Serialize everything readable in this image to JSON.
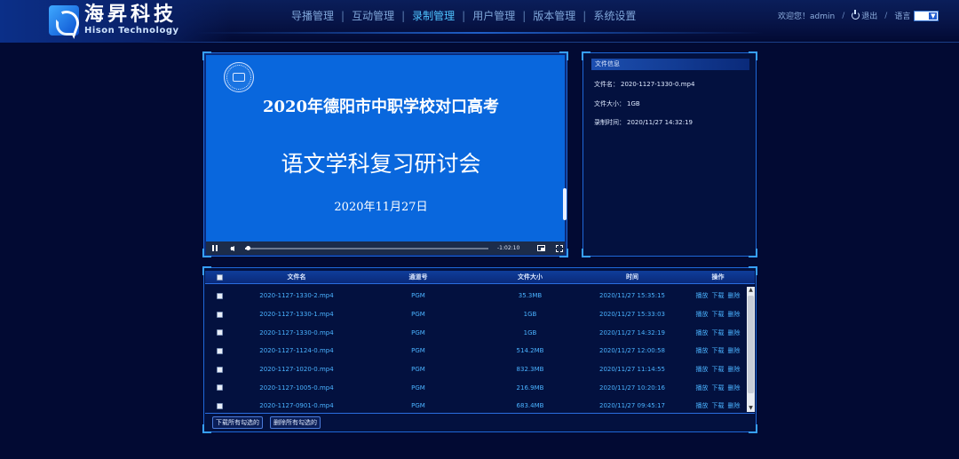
{
  "brand": {
    "name_cn": "海昇科技",
    "name_en": "Hison Technology"
  },
  "nav": {
    "items": [
      {
        "label": "导播管理",
        "active": false
      },
      {
        "label": "互动管理",
        "active": false
      },
      {
        "label": "录制管理",
        "active": true
      },
      {
        "label": "用户管理",
        "active": false
      },
      {
        "label": "版本管理",
        "active": false
      },
      {
        "label": "系统设置",
        "active": false
      }
    ],
    "separator": "|"
  },
  "user": {
    "welcome": "欢迎您！admin",
    "logout": "退出",
    "language": "语言",
    "sep": "/"
  },
  "player": {
    "slide_title": "2020年德阳市中职学校对口高考",
    "slide_subtitle": "语文学科复习研讨会",
    "slide_date": "2020年11月27日",
    "time_remaining": "-1:02:10",
    "progress": 0.01
  },
  "file_info": {
    "title": "文件信息",
    "name_label": "文件名：",
    "name": "2020-1127-1330-0.mp4",
    "size_label": "文件大小：",
    "size": "1GB",
    "time_label": "录制时间：",
    "time": "2020/11/27 14:32:19"
  },
  "table": {
    "headers": {
      "name": "文件名",
      "channel": "通道号",
      "size": "文件大小",
      "time": "时间",
      "ops": "操作"
    },
    "ops": {
      "play": "播放",
      "download": "下载",
      "delete": "删除"
    },
    "rows": [
      {
        "name": "2020-1127-1330-2.mp4",
        "channel": "PGM",
        "size": "35.3MB",
        "time": "2020/11/27 15:35:15"
      },
      {
        "name": "2020-1127-1330-1.mp4",
        "channel": "PGM",
        "size": "1GB",
        "time": "2020/11/27 15:33:03"
      },
      {
        "name": "2020-1127-1330-0.mp4",
        "channel": "PGM",
        "size": "1GB",
        "time": "2020/11/27 14:32:19"
      },
      {
        "name": "2020-1127-1124-0.mp4",
        "channel": "PGM",
        "size": "514.2MB",
        "time": "2020/11/27 12:00:58"
      },
      {
        "name": "2020-1127-1020-0.mp4",
        "channel": "PGM",
        "size": "832.3MB",
        "time": "2020/11/27 11:14:55"
      },
      {
        "name": "2020-1127-1005-0.mp4",
        "channel": "PGM",
        "size": "216.9MB",
        "time": "2020/11/27 10:20:16"
      },
      {
        "name": "2020-1127-0901-0.mp4",
        "channel": "PGM",
        "size": "683.4MB",
        "time": "2020/11/27 09:45:17"
      }
    ],
    "download_selected": "下载所有勾选的",
    "delete_selected": "删除所有勾选的"
  },
  "colors": {
    "background": "#020a33",
    "accent": "#37a0ff",
    "link": "#4ab2ff",
    "slide": "#0967dd"
  }
}
